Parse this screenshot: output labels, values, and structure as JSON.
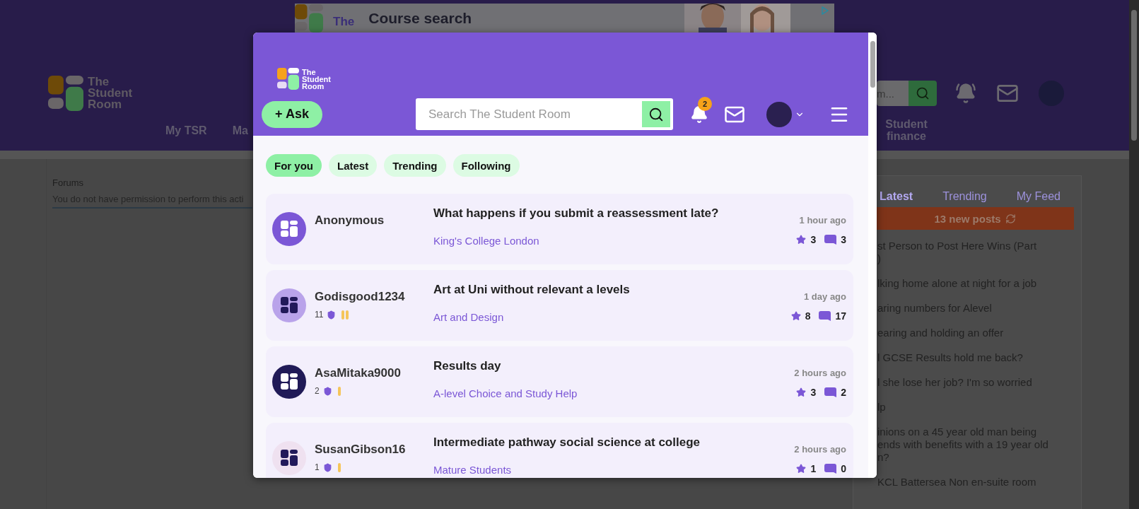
{
  "page": {
    "ad": {
      "logo_text": "The",
      "headline": "Course search"
    },
    "header": {
      "logo_text": "The Student Room",
      "search_value": "m...",
      "nav": [
        "My TSR",
        "Ma",
        "Student finance"
      ]
    },
    "content": {
      "breadcrumb": "Forums",
      "message": "You do not have permission to perform this acti"
    },
    "sidebar": {
      "tabs": [
        {
          "label": "Latest",
          "selected": true
        },
        {
          "label": "Trending",
          "selected": false
        },
        {
          "label": "My Feed",
          "selected": false
        }
      ],
      "new_posts": "13 new posts",
      "items": [
        "st Person to Post Here Wins (Part\n)",
        "lking home alone at night for a job",
        "aring numbers for Alevel",
        "earing and holding an offer",
        "l GCSE Results hold me back?",
        "l she lose her job? I'm so worried",
        "lp",
        "inions on a 45 year old man being\nends with benefits with a 19 year old\nn?",
        "KCL Battersea Non en-suite room"
      ]
    }
  },
  "popup": {
    "logo_text": "The Student Room",
    "ask_button": "+ Ask",
    "search": {
      "placeholder": "Search The Student Room"
    },
    "notifications": "2",
    "tabs": [
      {
        "label": "For you",
        "selected": true
      },
      {
        "label": "Latest",
        "selected": false
      },
      {
        "label": "Trending",
        "selected": false
      },
      {
        "label": "Following",
        "selected": false
      }
    ],
    "posts": [
      {
        "author": "Anonymous",
        "color": "#7b57d6",
        "title": "What happens if you submit a reassessment late?",
        "forum": "King's College London",
        "time": "1 hour ago",
        "likes": "3",
        "replies": "3"
      },
      {
        "author": "Godisgood1234",
        "color": "#b9a3ea",
        "badge": {
          "count": "11",
          "kind": "double"
        },
        "title": "Art at Uni without relevant a levels",
        "forum": "Art and Design",
        "time": "1 day ago",
        "likes": "8",
        "replies": "17"
      },
      {
        "author": "AsaMitaka9000",
        "color": "#201a57",
        "badge": {
          "count": "2",
          "kind": "single"
        },
        "title": "Results day",
        "forum": "A-level Choice and Study Help",
        "time": "2 hours ago",
        "likes": "3",
        "replies": "2"
      },
      {
        "author": "SusanGibson16",
        "color": "#efe1f0",
        "badge": {
          "count": "1",
          "kind": "single"
        },
        "title": "Intermediate pathway social science at college",
        "forum": "Mature Students",
        "time": "2 hours ago",
        "likes": "1",
        "replies": "0"
      }
    ]
  }
}
